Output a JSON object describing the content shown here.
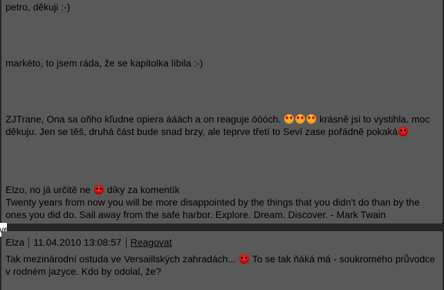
{
  "comments_top": {
    "c1": "petro, děkuji :-)",
    "c2": "markéto, to jsem ráda, že se kapitolka líbila :-)",
    "c3_a": "ZJTrane, Ona sa oňho kľudne opiera ááách a on reaguje óóóch.",
    "c3_b": "krásně jsi to vystihla. moc děkuju. Jen se těš, druhá část bude snad brzy, ale teprve třetí to Seví zase pořádně pokaká",
    "c4_a": "Elzo, no já určitě ne",
    "c4_b": "díky za komentík",
    "signature": "Twenty years from now you will be more disappointed by the things that you didn't do than by the ones you did do. Sail away from the safe harbor. Explore. Dream. Discover. - Mark Twain"
  },
  "side_tab": "ve",
  "comment_next": {
    "author": "Elza",
    "datetime": "11.04.2010 13:08:57",
    "reply_label": "Reagovat",
    "text_a": "Tak mezinárodní ostuda ve Versaillských zahradách...",
    "text_b": "To se tak ňáká má - soukromého průvodce v rodném jazyce. Kdo by odolal, že?"
  },
  "icons": [
    "heart-eyes-smiley-icon",
    "angry-smiley-icon"
  ]
}
